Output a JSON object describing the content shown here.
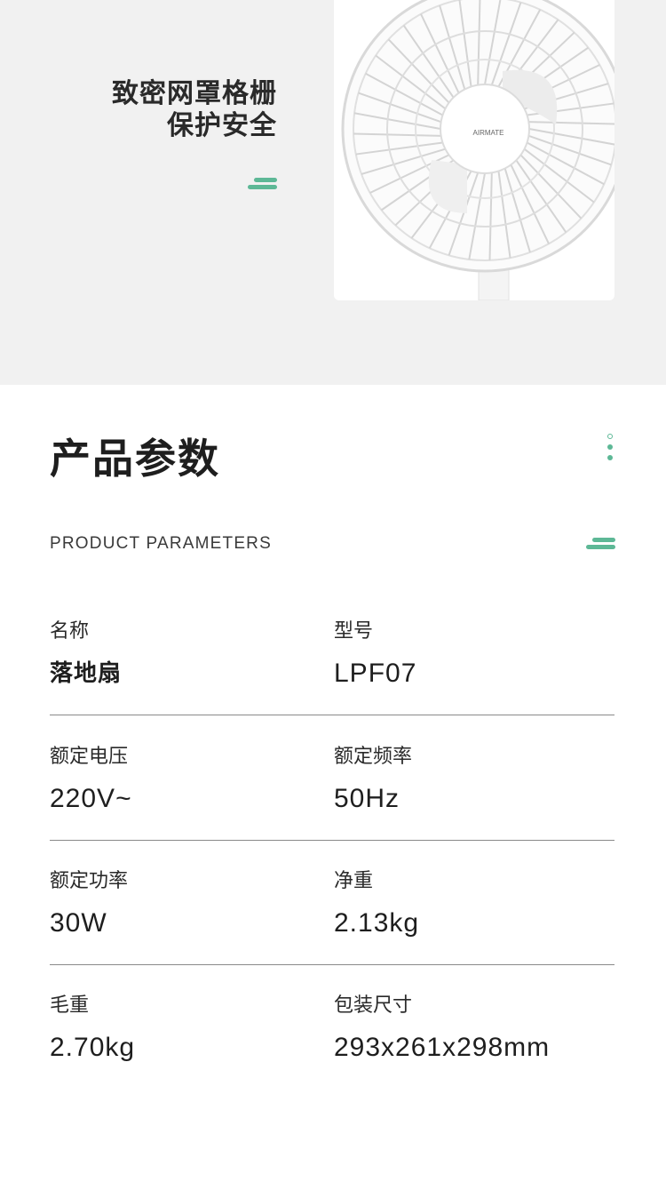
{
  "feature": {
    "title_line1": "致密网罩格栅",
    "title_line2": "保护安全",
    "brand_logo": "AIRMATE"
  },
  "params": {
    "title": "产品参数",
    "subtitle": "PRODUCT PARAMETERS",
    "rows": [
      {
        "left": {
          "label": "名称",
          "value": "落地扇"
        },
        "right": {
          "label": "型号",
          "value": "LPF07"
        }
      },
      {
        "left": {
          "label": "额定电压",
          "value": "220V~"
        },
        "right": {
          "label": "额定频率",
          "value": "50Hz"
        }
      },
      {
        "left": {
          "label": "额定功率",
          "value": "30W"
        },
        "right": {
          "label": "净重",
          "value": "2.13kg"
        }
      },
      {
        "left": {
          "label": "毛重",
          "value": "2.70kg"
        },
        "right": {
          "label": "包装尺寸",
          "value": "293x261x298mm"
        }
      }
    ]
  },
  "colors": {
    "accent": "#5db896",
    "top_background": "#f1f1f1"
  }
}
